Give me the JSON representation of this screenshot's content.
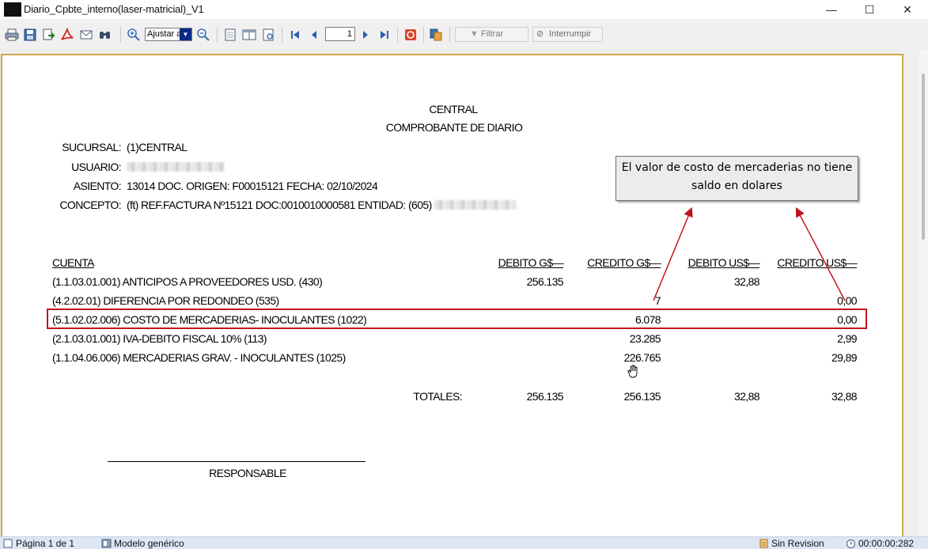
{
  "window": {
    "title": "Diario_Cpbte_interno(laser-matricial)_V1",
    "controls": {
      "minimize": "—",
      "maximize": "☐",
      "close": "✕"
    }
  },
  "toolbar": {
    "zoom_value": "Ajustar a",
    "page_value": "1",
    "filter_label": "Filtrar",
    "interrupt_label": "Interrumpir",
    "icons": [
      "print-icon",
      "save-icon",
      "export-icon",
      "pdf-icon",
      "email-icon",
      "find-icon",
      "zoom-in-icon",
      "zoom-out-icon",
      "single-page-icon",
      "two-page-icon",
      "page-setup-icon",
      "first-page-icon",
      "previous-page-icon",
      "next-page-icon",
      "last-page-icon",
      "stop-icon",
      "copy-icon",
      "filter-icon",
      "interrupt-icon"
    ]
  },
  "report": {
    "company": "CENTRAL",
    "doc_title": "COMPROBANTE DE DIARIO",
    "sucursal_label": "SUCURSAL:",
    "sucursal_value": "(1)CENTRAL",
    "usuario_label": "USUARIO:",
    "asiento_label": "ASIENTO:",
    "asiento_value": "13014  DOC. ORIGEN: F00015121  FECHA: 02/10/2024",
    "concepto_label": "CONCEPTO:",
    "concepto_value": "(ft) REF.FACTURA Nº15121 DOC:0010010000581 ENTIDAD: (605)",
    "columns": {
      "cuenta": "CUENTA",
      "debito_gs": "DEBITO G$—",
      "credito_gs": "CREDITO G$—",
      "debito_us": "DEBITO US$—",
      "credito_us": "CREDITO US$—"
    },
    "rows": [
      {
        "cuenta": "(1.1.03.01.001) ANTICIPOS A PROVEEDORES USD. (430)",
        "debito_gs": "256.135",
        "credito_gs": "",
        "debito_us": "32,88",
        "credito_us": ""
      },
      {
        "cuenta": "(4.2.02.01) DIFERENCIA POR REDONDEO (535)",
        "debito_gs": "",
        "credito_gs": "7",
        "debito_us": "",
        "credito_us": "0,00"
      },
      {
        "cuenta": "(5.1.02.02.006) COSTO DE MERCADERIAS- INOCULANTES (1022)",
        "debito_gs": "",
        "credito_gs": "6.078",
        "debito_us": "",
        "credito_us": "0,00"
      },
      {
        "cuenta": "(2.1.03.01.001) IVA-DEBITO FISCAL 10% (113)",
        "debito_gs": "",
        "credito_gs": "23.285",
        "debito_us": "",
        "credito_us": "2,99"
      },
      {
        "cuenta": "(1.1.04.06.006) MERCADERIAS GRAV. - INOCULANTES (1025)",
        "debito_gs": "",
        "credito_gs": "226.765",
        "debito_us": "",
        "credito_us": "29,89"
      }
    ],
    "totals_label": "TOTALES:",
    "totals": {
      "debito_gs": "256.135",
      "credito_gs": "256.135",
      "debito_us": "32,88",
      "credito_us": "32,88"
    },
    "responsable_label": "RESPONSABLE"
  },
  "annotation": {
    "line1": "El valor de costo de mercaderias no tiene",
    "line2": "saldo en dolares",
    "color": "#c0141c"
  },
  "status": {
    "page": "Página 1 de 1",
    "model": "Modelo genérico",
    "revision": "Sin Revision",
    "time": "00:00:00:282"
  }
}
